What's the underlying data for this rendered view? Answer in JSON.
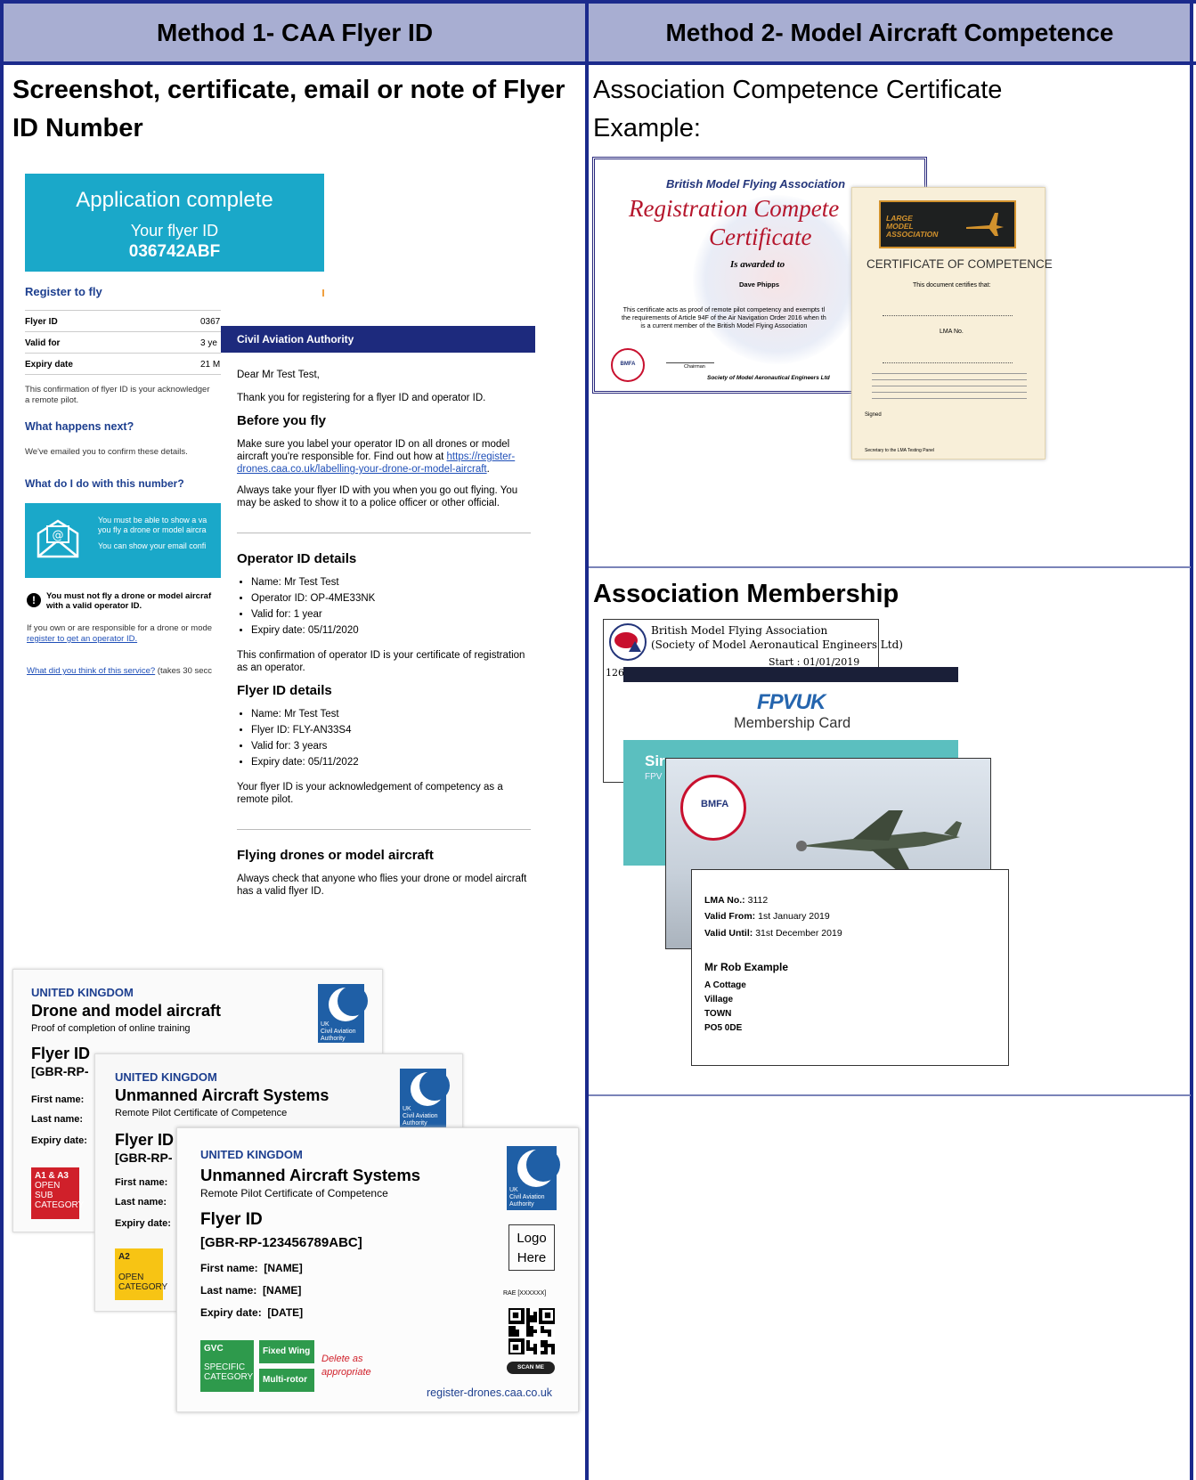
{
  "table": {
    "col1_header": "Method 1- CAA Flyer ID",
    "col2_header": "Method 2- Model Aircraft Competence"
  },
  "left": {
    "heading_line1": "Screenshot, certificate, email or note of Flyer",
    "heading_line2": "ID Number",
    "app_card": {
      "title": "Application complete",
      "subtitle": "Your flyer ID",
      "flyer_id": "036742ABF"
    },
    "register": {
      "title": "Register to fly",
      "rows": [
        {
          "label": "Flyer ID",
          "value": "0367"
        },
        {
          "label": "Valid for",
          "value": "3 ye"
        },
        {
          "label": "Expiry date",
          "value": "21 M"
        }
      ],
      "confirm_text": "This confirmation of flyer ID is your acknowledger",
      "confirm_text2": "a remote pilot.",
      "next_title": "What happens next?",
      "next_text": "We've emailed you to confirm these details.",
      "do_title": "What do I do with this number?",
      "info_line1": "You must be able to show a va",
      "info_line2": "you fly a drone or model aircra",
      "info_line3": "You can show your email confi",
      "warn_line1": "You must not fly a drone or model aircraf",
      "warn_line2": "with a valid operator ID.",
      "own_line1": "If you own or are responsible for a drone or mode",
      "own_link": "register to get an operator ID.",
      "feedback_link": "What did you think of this service?",
      "feedback_rest": "(takes 30 secc"
    },
    "email": {
      "bar": "Civil Aviation Authority",
      "greeting": "Dear Mr Test Test,",
      "thanks": "Thank you for registering for a flyer ID and operator ID.",
      "before_title": "Before you fly",
      "before_p1a": "Make sure you label your operator ID on all drones or model",
      "before_p1b": "aircraft you're responsible for. Find out how at",
      "before_link1": "https://register-",
      "before_link2": "drones.caa.co.uk/labelling-your-drone-or-model-aircraft",
      "before_p2a": "Always take your flyer ID with you when you go out flying. You",
      "before_p2b": "may be asked to show it to a police officer or other official.",
      "op_title": "Operator ID details",
      "op_items": [
        "Name: Mr Test Test",
        "Operator ID: OP-4ME33NK",
        "Valid for: 1 year",
        "Expiry date: 05/11/2020"
      ],
      "op_note1": "This confirmation of operator ID is your certificate of registration",
      "op_note2": "as an operator.",
      "fly_title": "Flyer ID details",
      "fly_items": [
        "Name: Mr Test Test",
        "Flyer ID: FLY-AN33S4",
        "Valid for: 3 years",
        "Expiry date: 05/11/2022"
      ],
      "fly_note1": "Your flyer ID is your acknowledgement of competency as a",
      "fly_note2": "remote pilot.",
      "drones_title": "Flying drones or model aircraft",
      "drones_p1": "Always check that anyone who flies your drone or model aircraft",
      "drones_p2": "has a valid flyer ID."
    },
    "cert1": {
      "country": "UNITED KINGDOM",
      "title": "Drone and model aircraft",
      "sub": "Proof of completion of online training",
      "flyer": "Flyer ID",
      "id": "[GBR-RP-",
      "first": "First name:",
      "last": "Last name:",
      "expiry": "Expiry date:",
      "tag_l1": "A1 & A3",
      "tag_l2": "OPEN",
      "tag_l3": "SUB",
      "tag_l4": "CATEGORY"
    },
    "cert2": {
      "country": "UNITED KINGDOM",
      "title": "Unmanned Aircraft Systems",
      "sub": "Remote Pilot Certificate of Competence",
      "flyer": "Flyer ID",
      "id": "[GBR-RP-",
      "first": "First name:",
      "last": "Last name:",
      "expiry": "Expiry date:",
      "tag_l1": "A2",
      "tag_l2": "OPEN",
      "tag_l3": "CATEGORY"
    },
    "cert3": {
      "country": "UNITED KINGDOM",
      "title": "Unmanned Aircraft Systems",
      "sub": "Remote Pilot Certificate of Competence",
      "flyer": "Flyer ID",
      "id": "[GBR-RP-123456789ABC]",
      "first": "First name:",
      "first_val": "[NAME]",
      "last": "Last name:",
      "last_val": "[NAME]",
      "expiry": "Expiry date:",
      "expiry_val": "[DATE]",
      "logo_l1": "Logo",
      "logo_l2": "Here",
      "rae": "RAE [XXXXXX]",
      "gvc": "GVC",
      "gvc_l2": "SPECIFIC",
      "gvc_l3": "CATEGORY",
      "fixed": "Fixed Wing",
      "multi": "Multi-rotor",
      "delete1": "Delete as",
      "delete2": "appropriate",
      "scan": "SCAN ME",
      "url": "register-drones.caa.co.uk"
    },
    "caa_logo": {
      "l1": "UK",
      "l2": "Civil Aviation",
      "l3": "Authority"
    }
  },
  "right": {
    "heading_line1": "Association Competence Certificate",
    "heading_line2": "Example:",
    "bmfa_cert": {
      "org": "British Model Flying Association",
      "title1": "Registration Compete",
      "title2": "Certificate",
      "awarded": "Is awarded to",
      "name": "Dave Phipps",
      "p1": "This certificate acts as proof of remote pilot competency and exempts tl",
      "p2": "the requirements of Article 94F of the Air Navigation Order 2016 when th",
      "p3": "is a current member of the British Model Flying Association",
      "chairman": "Chairman",
      "society": "Society of Model Aeronautical Engineers Ltd"
    },
    "lma_cert": {
      "logo1": "LARGE",
      "logo2": "MODEL",
      "logo3": "ASSOCIATION",
      "title": "CERTIFICATE OF COMPETENCE",
      "certifies": "This document certifies that:",
      "lma_no": "LMA No.",
      "signed": "Signed",
      "footer": "Secretary to the LMA Testing Panel"
    },
    "membership_heading": "Association Membership",
    "bmfa_card": {
      "l1": "British Model Flying Association",
      "l2": "(Society of Model Aeronautical Engineers Ltd)",
      "start": "Start    : 01/01/2019",
      "num": "126"
    },
    "fpv_card": {
      "logo": "FPVUK",
      "title": "Membership Card",
      "name": "Sir",
      "sub": "FPV"
    },
    "spitfire_card": {
      "badge": "BMFA"
    },
    "lma_card": {
      "no_label": "LMA No.:",
      "no_val": "3112",
      "from_label": "Valid From:",
      "from_val": "1st January 2019",
      "until_label": "Valid Until:",
      "until_val": "31st December 2019",
      "name": "Mr Rob Example",
      "addr": [
        "A Cottage",
        "Village",
        "TOWN",
        "PO5 0DE"
      ]
    }
  },
  "colors": {
    "header_bg": "#a8aed2",
    "border": "#1b2a8c",
    "caa_teal": "#1aa8c9",
    "caa_navy": "#1d2a7d",
    "tag_red": "#d0202a",
    "tag_yellow": "#f7c414",
    "tag_green": "#2e9a4c"
  }
}
